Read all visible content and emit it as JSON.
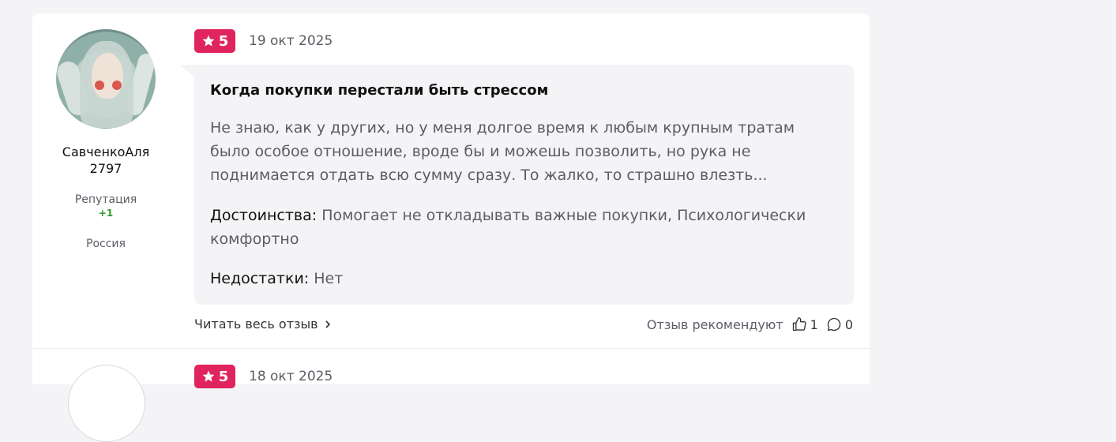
{
  "review": {
    "author": "СавченкоАля 2797",
    "reputation_label": "Репутация",
    "reputation_value": "+1",
    "country": "Россия",
    "rating": "5",
    "date": "19 окт 2025",
    "title": "Когда покупки перестали быть стрессом",
    "body": "Не знаю, как у других, но у меня долгое время к любым крупным тратам было особое отношение, вроде бы и можешь позволить, но рука не поднимается отдать всю сумму сразу. То жалко, то страшно влезть...",
    "pros_label": "Достоинства:",
    "pros": "Помогает не откладывать важные покупки, Психологически комфортно",
    "cons_label": "Недостатки:",
    "cons": "Нет",
    "read_more": "Читать весь отзыв",
    "recommend_label": "Отзыв рекомендуют",
    "likes": "1",
    "comments": "0"
  },
  "next_review": {
    "rating": "5",
    "date": "18 окт 2025"
  },
  "colors": {
    "accent": "#e0245e",
    "background": "#f4f4f6",
    "reputation_positive": "#2e9a2e"
  }
}
